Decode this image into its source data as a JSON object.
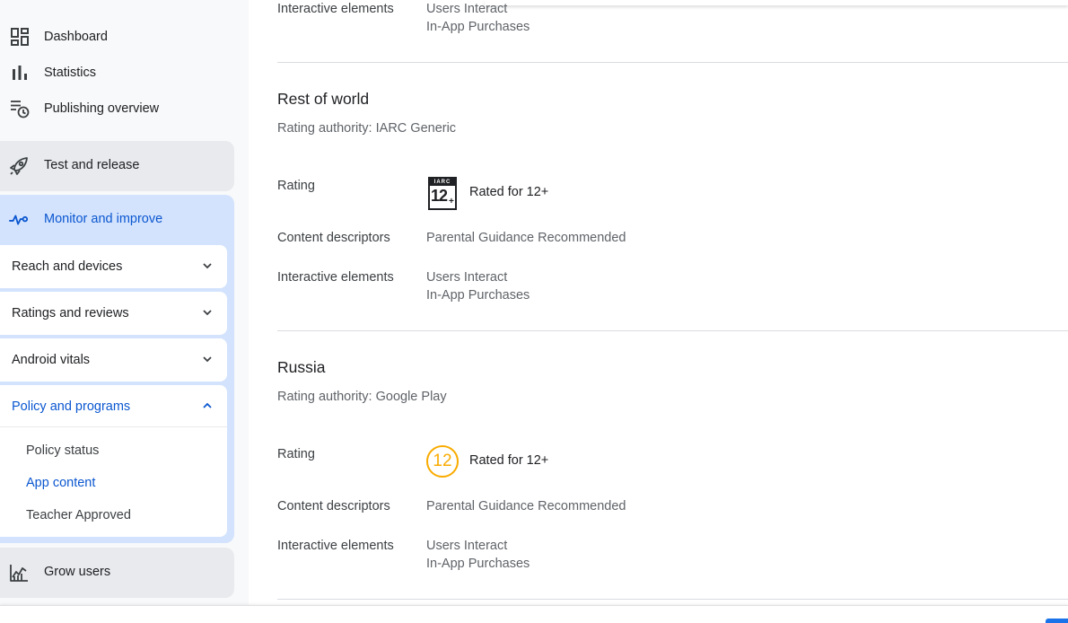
{
  "sidebar": {
    "top_items": [
      {
        "label": "Dashboard",
        "icon": "dashboard-icon"
      },
      {
        "label": "Statistics",
        "icon": "bar-chart-icon"
      },
      {
        "label": "Publishing overview",
        "icon": "publishing-overview-icon"
      }
    ],
    "sections": {
      "test_release": {
        "label": "Test and release",
        "icon": "rocket-icon"
      },
      "monitor": {
        "label": "Monitor and improve",
        "icon": "monitor-pulse-icon"
      },
      "grow": {
        "label": "Grow users",
        "icon": "grow-chart-icon"
      }
    },
    "monitor_children": [
      {
        "label": "Reach and devices",
        "expanded": false
      },
      {
        "label": "Ratings and reviews",
        "expanded": false
      },
      {
        "label": "Android vitals",
        "expanded": false
      },
      {
        "label": "Policy and programs",
        "expanded": true
      }
    ],
    "policy_children": [
      {
        "label": "Policy status",
        "active": false
      },
      {
        "label": "App content",
        "active": true
      },
      {
        "label": "Teacher Approved",
        "active": false
      }
    ]
  },
  "main": {
    "top_partial": {
      "interactive_label": "Interactive elements",
      "interactive_values": [
        "Users Interact",
        "In-App Purchases"
      ]
    },
    "regions": [
      {
        "title": "Rest of world",
        "authority": "Rating authority: IARC Generic",
        "rating_label": "Rating",
        "badge": {
          "type": "iarc",
          "header": "IARC",
          "number": "12",
          "plus": "+"
        },
        "rating_text": "Rated for 12+",
        "descriptors_label": "Content descriptors",
        "descriptors_value": "Parental Guidance Recommended",
        "interactive_label": "Interactive elements",
        "interactive_values": [
          "Users Interact",
          "In-App Purchases"
        ]
      },
      {
        "title": "Russia",
        "authority": "Rating authority: Google Play",
        "rating_label": "Rating",
        "badge": {
          "type": "circle",
          "number": "12"
        },
        "rating_text": "Rated for 12+",
        "descriptors_label": "Content descriptors",
        "descriptors_value": "Parental Guidance Recommended",
        "interactive_label": "Interactive elements",
        "interactive_values": [
          "Users Interact",
          "In-App Purchases"
        ]
      }
    ]
  },
  "colors": {
    "accent_blue": "#0b57d0",
    "section_blue_bg": "#d3e3fd",
    "section_grey_bg": "#e8eaed",
    "rating_orange": "#f9ab00"
  }
}
